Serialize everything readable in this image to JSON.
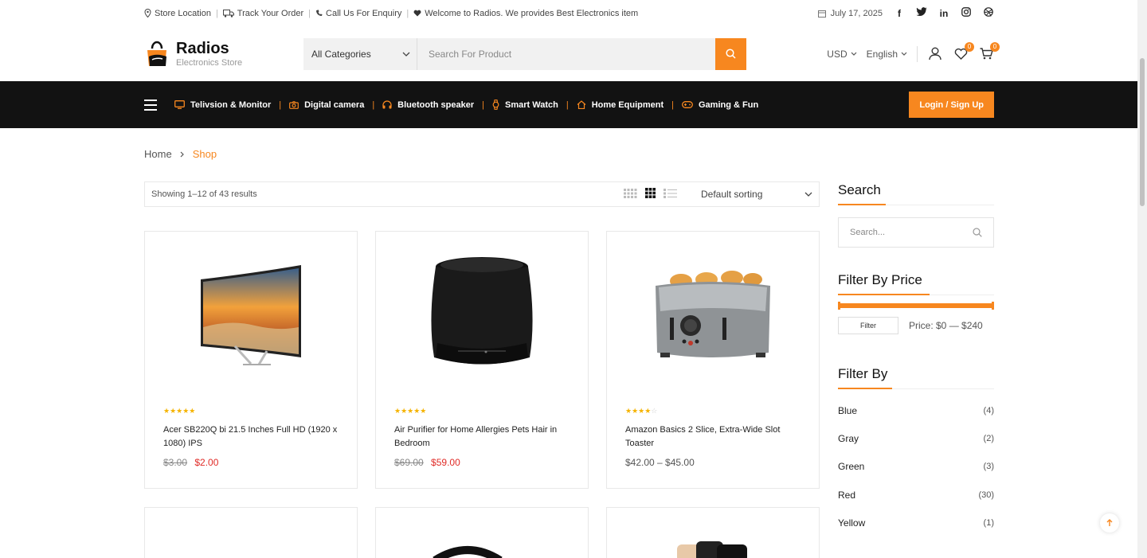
{
  "topbar": {
    "store_location": "Store Location",
    "track_order": "Track Your Order",
    "call_us": "Call Us For Enquiry",
    "welcome": "Welcome to Radios. We provides Best Electronics item",
    "date": "July 17, 2025",
    "social": [
      "facebook-icon",
      "twitter-icon",
      "linkedin-icon",
      "instagram-icon",
      "dribbble-icon"
    ]
  },
  "header": {
    "logo_title": "Radios",
    "logo_sub": "Electronics Store",
    "category": "All Categories",
    "search_placeholder": "Search For Product",
    "currency": "USD",
    "language": "English",
    "wishlist_count": "0",
    "cart_count": "0"
  },
  "nav": {
    "items": [
      "Telivsion & Monitor",
      "Digital camera",
      "Bluetooth speaker",
      "Smart Watch",
      "Home Equipment",
      "Gaming & Fun"
    ],
    "login": "Login / Sign Up"
  },
  "breadcrumb": {
    "home": "Home",
    "current": "Shop"
  },
  "toolbar": {
    "results": "Showing 1–12 of 43 results",
    "sorting": "Default sorting"
  },
  "products": [
    {
      "title": "Acer SB220Q bi 21.5 Inches Full HD (1920 x 1080) IPS",
      "old": "$3.00",
      "new": "$2.00",
      "rating": 5
    },
    {
      "title": "Air Purifier for Home Allergies Pets Hair in Bedroom",
      "old": "$69.00",
      "new": "$59.00",
      "rating": 5
    },
    {
      "title": "Amazon Basics 2 Slice, Extra-Wide Slot Toaster",
      "range": "$42.00 – $45.00",
      "rating": 4
    }
  ],
  "sidebar": {
    "search_title": "Search",
    "search_placeholder": "Search...",
    "price_title": "Filter By Price",
    "filter_btn": "Filter",
    "price_label": "Price: $0 — $240",
    "filter_by_title": "Filter By",
    "filters": [
      {
        "name": "Blue",
        "count": "(4)"
      },
      {
        "name": "Gray",
        "count": "(2)"
      },
      {
        "name": "Green",
        "count": "(3)"
      },
      {
        "name": "Red",
        "count": "(30)"
      },
      {
        "name": "Yellow",
        "count": "(1)"
      }
    ]
  },
  "colors": {
    "accent": "#f7871f",
    "nav_bg": "#121212",
    "sale": "#e02b27"
  }
}
